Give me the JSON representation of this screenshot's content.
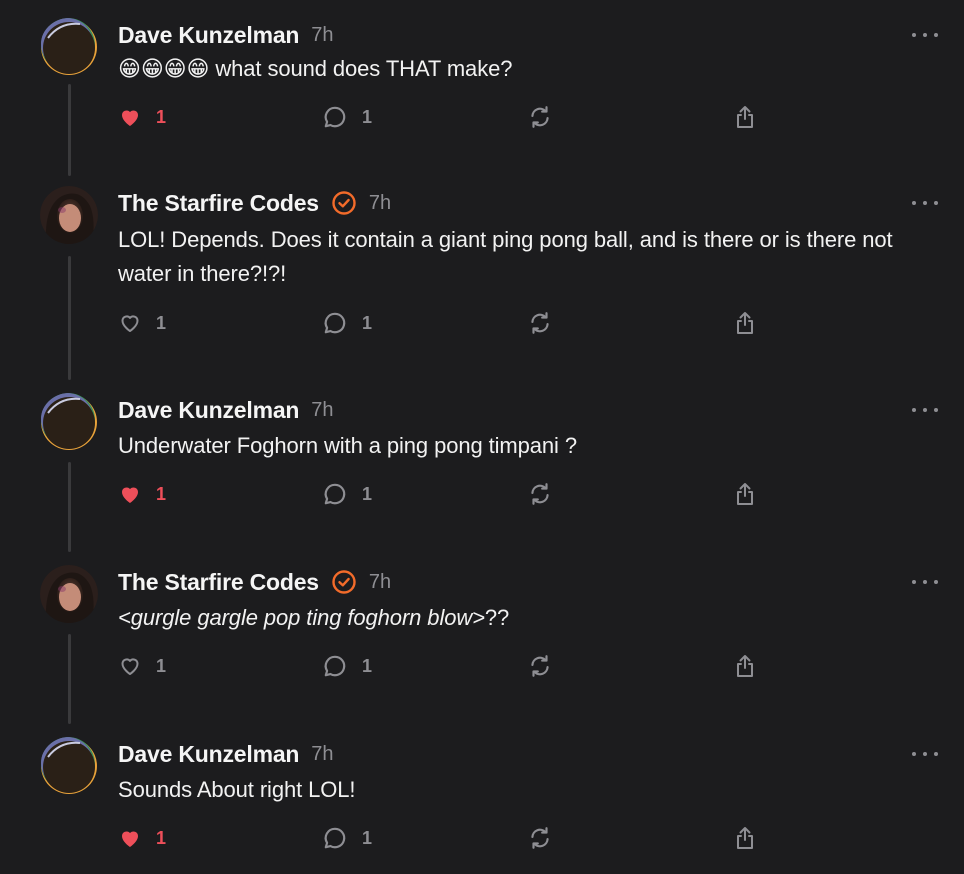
{
  "colors": {
    "background": "#1c1c1e",
    "like": "#ee4f5a",
    "verified": "#f26b2a",
    "muted": "#8e8e93"
  },
  "posts": [
    {
      "author": "Dave Kunzelman",
      "verified": false,
      "time": "7h",
      "text_prefix": "😁😁😁😁",
      "text": " what sound does THAT make?",
      "liked": true,
      "likes": "1",
      "replies": "1"
    },
    {
      "author": "The Starfire Codes",
      "verified": true,
      "time": "7h",
      "text_prefix": "",
      "text": "LOL! Depends. Does it contain a giant ping pong ball, and is there or is there not water in there?!?!",
      "liked": false,
      "likes": "1",
      "replies": "1"
    },
    {
      "author": "Dave Kunzelman",
      "verified": false,
      "time": "7h",
      "text_prefix": "",
      "text": "Underwater Foghorn with a ping pong timpani ?",
      "liked": true,
      "likes": "1",
      "replies": "1"
    },
    {
      "author": "The Starfire Codes",
      "verified": true,
      "time": "7h",
      "text_italic": "<gurgle gargle pop ting foghorn blow>",
      "text_after": "??",
      "liked": false,
      "likes": "1",
      "replies": "1"
    },
    {
      "author": "Dave Kunzelman",
      "verified": false,
      "time": "7h",
      "text_prefix": "",
      "text": "Sounds About right LOL!",
      "liked": true,
      "likes": "1",
      "replies": "1"
    }
  ]
}
